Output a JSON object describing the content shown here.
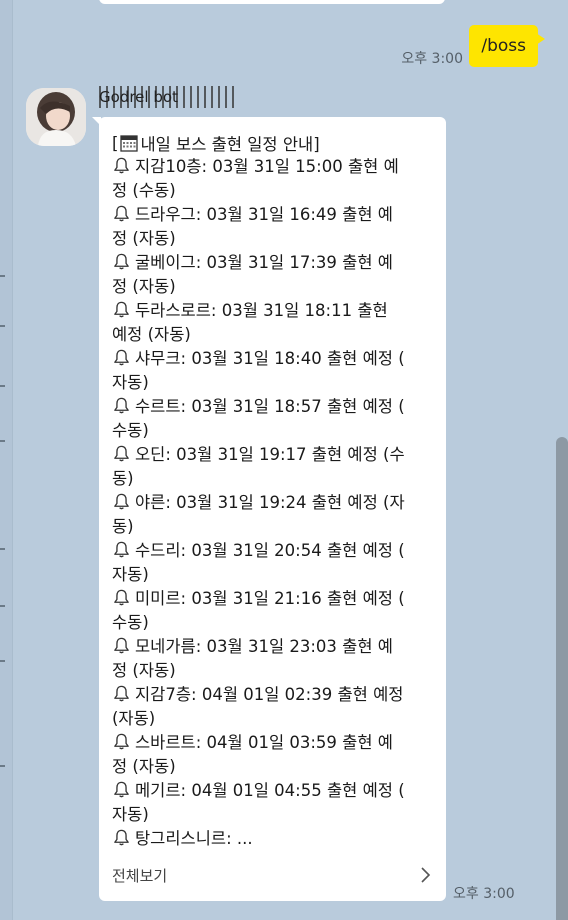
{
  "my_message": {
    "text": "/boss",
    "time": "오후 3:00"
  },
  "sender": {
    "name": "Godrel bot"
  },
  "message": {
    "title_prefix": "[",
    "title": "내일 보스 출현 일정 안내]",
    "lines": [
      {
        "icon": true,
        "text": "지감10층: 03월 31일 15:00 출현 예"
      },
      {
        "icon": false,
        "text": "정 (수동)"
      },
      {
        "icon": true,
        "text": "드라우그: 03월 31일 16:49 출현 예"
      },
      {
        "icon": false,
        "text": "정 (자동)"
      },
      {
        "icon": true,
        "text": "굴베이그: 03월 31일 17:39 출현 예"
      },
      {
        "icon": false,
        "text": "정 (자동)"
      },
      {
        "icon": true,
        "text": "두라스로르: 03월 31일 18:11 출현"
      },
      {
        "icon": false,
        "text": "예정 (자동)"
      },
      {
        "icon": true,
        "text": "샤무크: 03월 31일 18:40 출현 예정 ("
      },
      {
        "icon": false,
        "text": "자동)"
      },
      {
        "icon": true,
        "text": "수르트: 03월 31일 18:57 출현 예정 ("
      },
      {
        "icon": false,
        "text": "수동)"
      },
      {
        "icon": true,
        "text": "오딘: 03월 31일 19:17 출현 예정 (수"
      },
      {
        "icon": false,
        "text": "동)"
      },
      {
        "icon": true,
        "text": "야른: 03월 31일 19:24 출현 예정 (자"
      },
      {
        "icon": false,
        "text": "동)"
      },
      {
        "icon": true,
        "text": "수드리: 03월 31일 20:54 출현 예정 ("
      },
      {
        "icon": false,
        "text": "자동)"
      },
      {
        "icon": true,
        "text": "미미르: 03월 31일 21:16 출현 예정 ("
      },
      {
        "icon": false,
        "text": "수동)"
      },
      {
        "icon": true,
        "text": "모네가름: 03월 31일 23:03 출현 예"
      },
      {
        "icon": false,
        "text": "정 (자동)"
      },
      {
        "icon": true,
        "text": "지감7층: 04월 01일 02:39 출현 예정"
      },
      {
        "icon": false,
        "text": " (자동)"
      },
      {
        "icon": true,
        "text": "스바르트: 04월 01일 03:59 출현 예"
      },
      {
        "icon": false,
        "text": "정 (자동)"
      },
      {
        "icon": true,
        "text": "메기르: 04월 01일 04:55 출현 예정 ("
      },
      {
        "icon": false,
        "text": "자동)"
      },
      {
        "icon": true,
        "text": "탕그리스니르: ..."
      }
    ],
    "view_all_label": "전체보기",
    "time": "오후 3:00"
  },
  "colors": {
    "background": "#b9cbdc",
    "my_bubble": "#fee500",
    "their_bubble": "#ffffff"
  },
  "icons": {
    "bell": "bell-icon",
    "calendar": "calendar-icon",
    "chevron": "chevron-right-icon"
  }
}
